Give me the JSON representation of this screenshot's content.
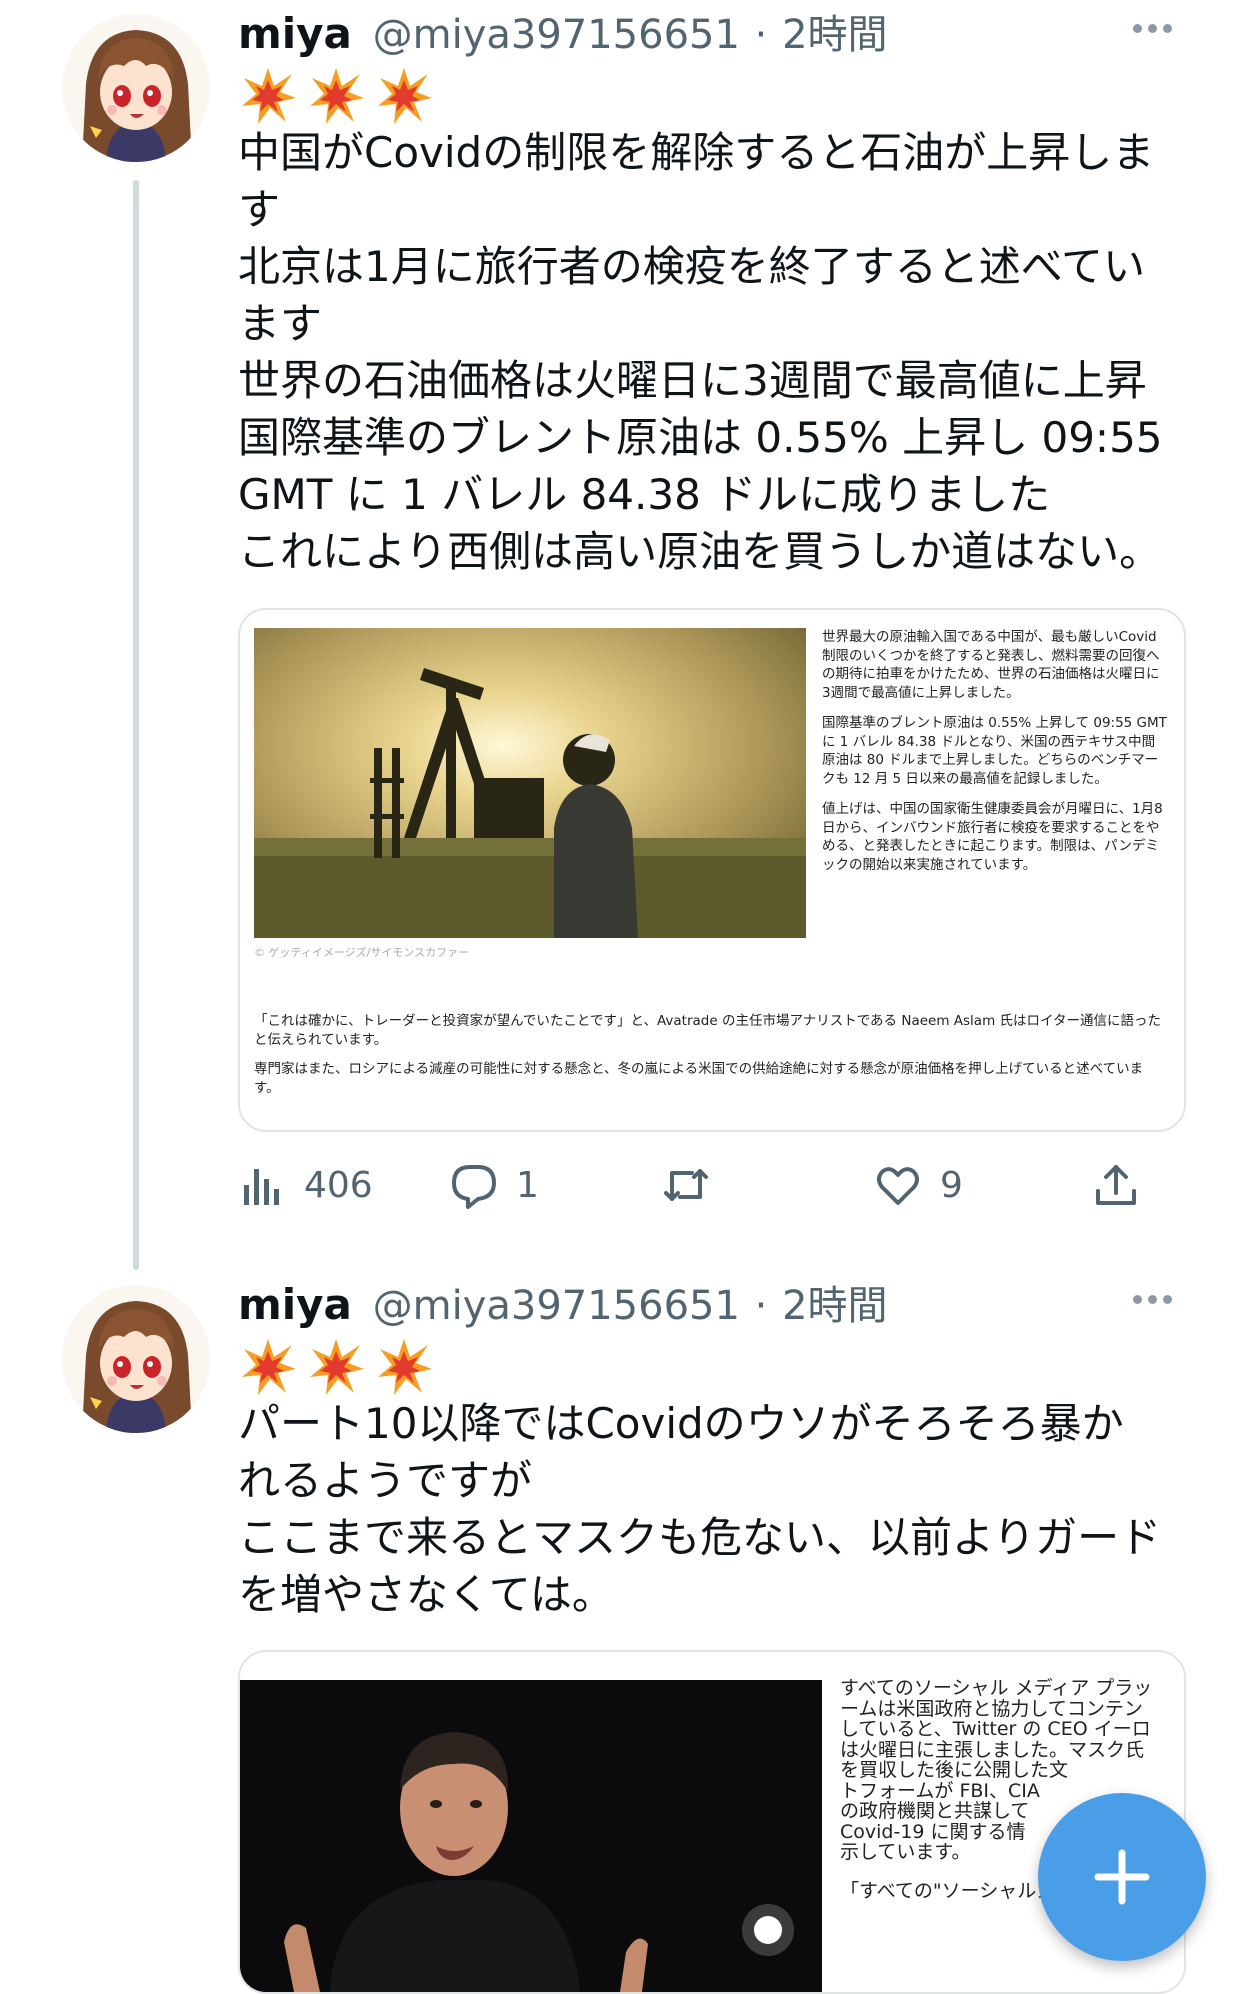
{
  "tweets": [
    {
      "user": {
        "name": "miya",
        "handle": "@miya397156651",
        "time": "2時間",
        "sep": "·"
      },
      "emojis": [
        "collision-emoji",
        "collision-emoji",
        "collision-emoji"
      ],
      "lines": [
        "中国がCovidの制限を解除すると石油が上昇しま",
        "す",
        "北京は1月に旅行者の検疫を終了すると述べてい",
        "ます",
        "世界の石油価格は火曜日に3週間で最高値に上昇",
        "国際基準のブレント原油は 0.55% 上昇し 09:55",
        "GMT に 1 バレル 84.38 ドルに成りました",
        "これにより西側は高い原油を買うしか道はない。"
      ],
      "card": {
        "column": [
          "世界最大の原油輸入国である中国が、最も厳しいCovid制限のいくつかを終了すると発表し、燃料需要の回復への期待に拍車をかけたため、世界の石油価格は火曜日に3週間で最高値に上昇しました。",
          "国際基準のブレント原油は 0.55% 上昇して 09:55 GMT に 1 バレル 84.38 ドルとなり、米国の西テキサス中間原油は 80 ドルまで上昇しました。どちらのベンチマークも 12 月 5 日以来の最高値を記録しました。",
          "値上げは、中国の国家衛生健康委員会が月曜日に、1月8日から、インバウンド旅行者に検疫を要求することをやめる、と発表したときに起こります。制限は、パンデミックの開始以来実施されています。"
        ],
        "caption": "© ゲッティイメージズ/サイモンスカファー",
        "footer": [
          "「これは確かに、トレーダーと投資家が望んでいたことです」と、Avatrade の主任市場アナリストである Naeem Aslam 氏はロイター通信に語ったと伝えられています。",
          "専門家はまた、ロシアによる減産の可能性に対する懸念と、冬の嵐による米国での供給途絶に対する懸念が原油価格を押し上げていると述べています。"
        ]
      },
      "actions": {
        "views": "406",
        "replies": "1",
        "retweets": "",
        "likes": "9"
      }
    },
    {
      "user": {
        "name": "miya",
        "handle": "@miya397156651",
        "time": "2時間",
        "sep": "·"
      },
      "emojis": [
        "collision-emoji",
        "collision-emoji",
        "collision-emoji"
      ],
      "lines": [
        "パート10以降ではCovidのウソがそろそろ暴か",
        "れるようですが",
        "ここまで来るとマスクも危ない、以前よりガード",
        "を増やさなくては。"
      ],
      "card": {
        "column_lines": [
          "すべてのソーシャル メディア プラッ",
          "ームは米国政府と協力してコンテン",
          "していると、Twitter の CEO イーロ",
          "は火曜日に主張しました。マスク氏",
          "を買収した後に公開した文",
          "トフォームが FBI、CIA",
          "の政府機関と共謀して",
          "Covid-19 に関する情",
          "示しています。",
          "「すべての\"ソーシャルメディア\"企業"
        ]
      }
    }
  ],
  "colors": {
    "text": "#0f1419",
    "muted": "#536471",
    "accent": "#4a9ee8",
    "line": "#cfd9de"
  }
}
